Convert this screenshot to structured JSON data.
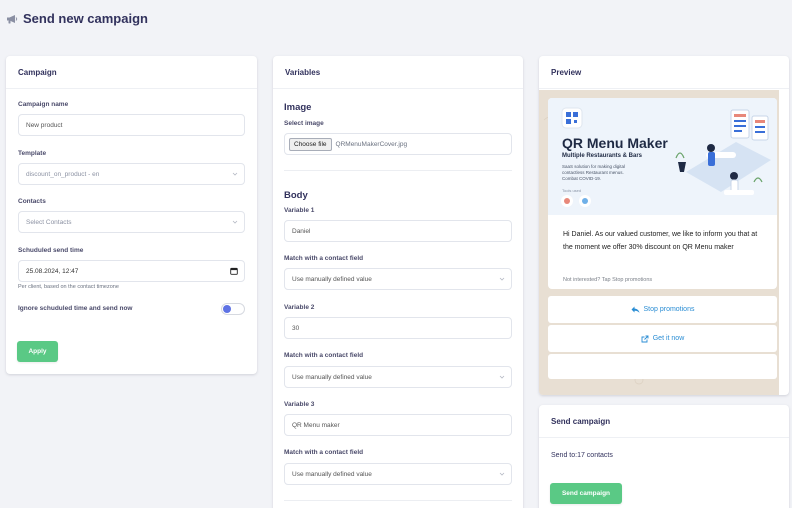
{
  "page": {
    "title": "Send new campaign",
    "icon": "megaphone-icon"
  },
  "campaign_card": {
    "title": "Campaign",
    "campaign_name_label": "Campaign name",
    "campaign_name_value": "New product",
    "template_label": "Template",
    "template_value": "discount_on_product - en",
    "contacts_label": "Contacts",
    "contacts_placeholder": "Select Contacts",
    "schedule_label": "Schuduled send time",
    "schedule_value": "25.08.2024, 12:47",
    "schedule_hint": "Per client, based on the contact timezone",
    "ignore_label": "Ignore schuduled time and send now",
    "ignore_toggle_on": true,
    "apply_label": "Apply"
  },
  "variables_card": {
    "title": "Variables",
    "image_section": "Image",
    "select_image_label": "Select image",
    "choose_file_label": "Choose file",
    "file_name": "QRMenuMakerCover.jpg",
    "body_section": "Body",
    "variables": [
      {
        "label": "Variable 1",
        "value": "Daniel",
        "match_label": "Match with a contact field",
        "match_value": "Use manually defined value"
      },
      {
        "label": "Variable 2",
        "value": "30",
        "match_label": "Match with a contact field",
        "match_value": "Use manually defined value"
      },
      {
        "label": "Variable 3",
        "value": "QR Menu maker",
        "match_label": "Match with a contact field",
        "match_value": "Use manually defined value"
      }
    ]
  },
  "preview_card": {
    "title": "Preview",
    "banner": {
      "headline": "QR Menu Maker",
      "subhead": "Multiple Restaurants & Bars",
      "desc_line1": "SaaS solution for making digital",
      "desc_line2": "contactless Restaurant menus.",
      "desc_line3": "Combat COVID-19.",
      "tools_label": "Tools used"
    },
    "message": "Hi Daniel. As our valued customer, we like to inform you that at the moment we offer 30% discount on QR Menu maker",
    "footer": "Not interested? Tap Stop promotions",
    "buttons": [
      {
        "label": "Stop promotions",
        "icon": "reply-icon"
      },
      {
        "label": "Get it now",
        "icon": "external-link-icon"
      }
    ]
  },
  "send_card": {
    "title": "Send campaign",
    "send_to": "Send to:17 contacts",
    "button_label": "Send campaign"
  },
  "colors": {
    "accent_green": "#5ac985",
    "toggle_blue": "#5e72e4",
    "link_blue": "#2a8dd4",
    "page_bg": "#f2f3f7"
  }
}
